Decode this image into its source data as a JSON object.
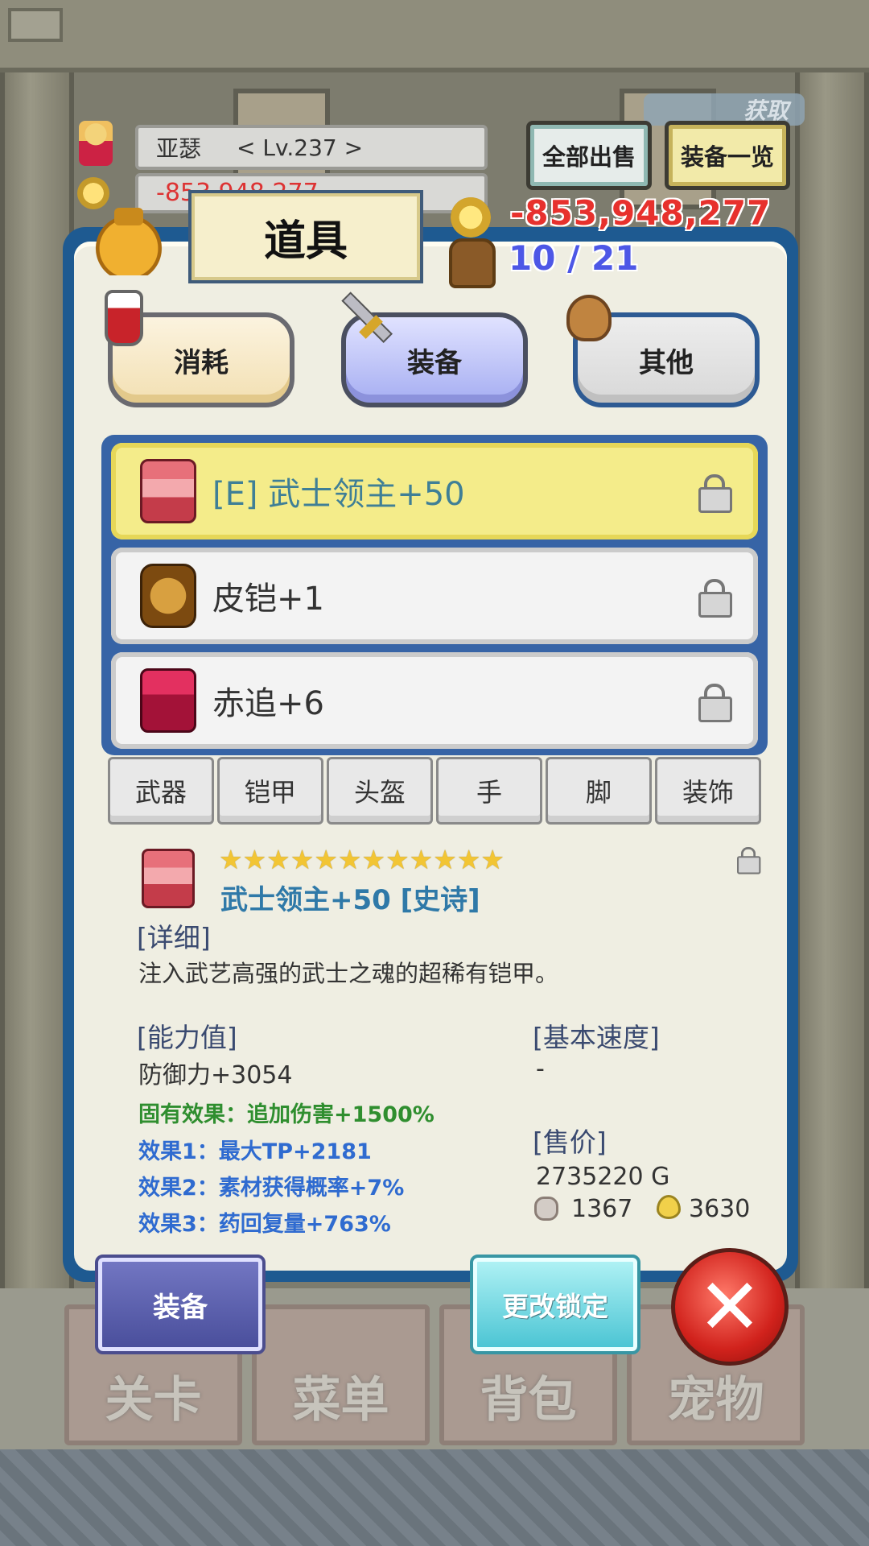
{
  "hud": {
    "player_name": "亚瑟",
    "level": "< Lv.237 >",
    "money_shadow": "-853,948,277",
    "sell_all_label": "全部出售",
    "equipment_list_label": "装备一览",
    "gain_label": "获取"
  },
  "panel": {
    "title": "道具",
    "money": "-853,948,277",
    "capacity": "10 / 21"
  },
  "category_tabs": [
    {
      "label": "消耗",
      "icon": "potion-icon"
    },
    {
      "label": "装备",
      "icon": "sword-icon",
      "selected": true
    },
    {
      "label": "其他",
      "icon": "sack-icon"
    }
  ],
  "items": [
    {
      "name": "[E] 武士领主+50",
      "icon": "samurai-armor-icon",
      "selected": true
    },
    {
      "name": "皮铠+1",
      "icon": "leather-armor-icon"
    },
    {
      "name": "赤追+6",
      "icon": "red-armor-icon"
    }
  ],
  "slot_tabs": [
    "武器",
    "铠甲",
    "头盔",
    "手",
    "脚",
    "装饰"
  ],
  "detail": {
    "stars": "★★★★★★★★★★★★",
    "title": "武士领主+50 [史诗]",
    "detail_label": "[详细]",
    "description": "注入武艺高强的武士之魂的超稀有铠甲。",
    "stats_label": "[能力值]",
    "defense": "防御力+3054",
    "inherent_effect": "固有效果：追加伤害+1500%",
    "effect1": "效果1：最大TP+2181",
    "effect2": "效果2：素材获得概率+7%",
    "effect3": "效果3：药回复量+763%",
    "speed_label": "[基本速度]",
    "speed_value": "-",
    "price_label": "[售价]",
    "price_value": "2735220 G",
    "material_ore": "1367",
    "material_drop": "3630"
  },
  "actions": {
    "equip_label": "装备",
    "change_lock_label": "更改锁定",
    "close_label": "✕"
  },
  "nav": [
    "关卡",
    "菜单",
    "背包",
    "宠物"
  ],
  "colors": {
    "panel_border": "#1e5a91",
    "money": "#e7312d",
    "capacity": "#4d57e6",
    "selected_row": "#f4ec8a",
    "effect_green": "#2f8e2f",
    "effect_blue": "#2f6bd0"
  }
}
